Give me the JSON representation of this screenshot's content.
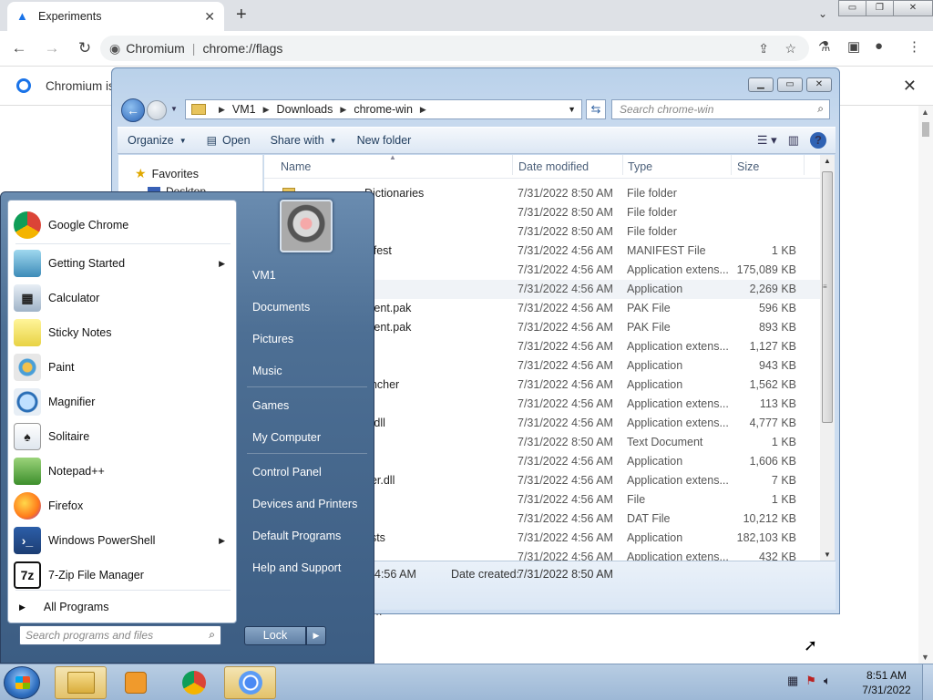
{
  "browser": {
    "tab_title": "Experiments",
    "tab_close": "✕",
    "new_tab": "+",
    "tab_dropdown": "⌄",
    "window_controls": [
      "▭",
      "❐",
      "✕"
    ],
    "site_name": "Chromium",
    "url": "chrome://flags",
    "infobar_text": "Chromium is",
    "infobar_close": "✕",
    "faint_text": "...."
  },
  "explorer": {
    "window_controls": [
      "▭",
      "▭",
      "✕"
    ],
    "breadcrumb": [
      "VM1",
      "Downloads",
      "chrome-win"
    ],
    "search_placeholder": "Search chrome-win",
    "commands": {
      "organize": "Organize",
      "open": "Open",
      "share_with": "Share with",
      "new_folder": "New folder"
    },
    "nav": {
      "favorites": "Favorites",
      "desktop": "Desktop"
    },
    "columns": {
      "name": "Name",
      "date_modified": "Date modified",
      "type": "Type",
      "size": "Size"
    },
    "rows": [
      {
        "name": "Dictionaries",
        "date": "7/31/2022 8:50 AM",
        "type": "File folder",
        "size": ""
      },
      {
        "name": "",
        "date": "7/31/2022 8:50 AM",
        "type": "File folder",
        "size": ""
      },
      {
        "name": "",
        "date": "7/31/2022 8:50 AM",
        "type": "File folder",
        "size": ""
      },
      {
        "name": "nifest",
        "date": "7/31/2022 4:56 AM",
        "type": "MANIFEST File",
        "size": "1 KB"
      },
      {
        "name": "",
        "date": "7/31/2022 4:56 AM",
        "type": "Application extens...",
        "size": "175,089 KB"
      },
      {
        "name": "",
        "date": "7/31/2022 4:56 AM",
        "type": "Application",
        "size": "2,269 KB"
      },
      {
        "name": "rcent.pak",
        "date": "7/31/2022 4:56 AM",
        "type": "PAK File",
        "size": "596 KB"
      },
      {
        "name": "rcent.pak",
        "date": "7/31/2022 4:56 AM",
        "type": "PAK File",
        "size": "893 KB"
      },
      {
        "name": "",
        "date": "7/31/2022 4:56 AM",
        "type": "Application extens...",
        "size": "1,127 KB"
      },
      {
        "name": "",
        "date": "7/31/2022 4:56 AM",
        "type": "Application",
        "size": "943 KB"
      },
      {
        "name": "uncher",
        "date": "7/31/2022 4:56 AM",
        "type": "Application",
        "size": "1,562 KB"
      },
      {
        "name": "",
        "date": "7/31/2022 4:56 AM",
        "type": "Application extens...",
        "size": "113 KB"
      },
      {
        "name": "7.dll",
        "date": "7/31/2022 4:56 AM",
        "type": "Application extens...",
        "size": "4,777 KB"
      },
      {
        "name": "",
        "date": "7/31/2022 8:50 AM",
        "type": "Text Document",
        "size": "1 KB"
      },
      {
        "name": "e",
        "date": "7/31/2022 4:56 AM",
        "type": "Application",
        "size": "1,606 KB"
      },
      {
        "name": "der.dll",
        "date": "7/31/2022 4:56 AM",
        "type": "Application extens...",
        "size": "7 KB"
      },
      {
        "name": "",
        "date": "7/31/2022 4:56 AM",
        "type": "File",
        "size": "1 KB"
      },
      {
        "name": "",
        "date": "7/31/2022 4:56 AM",
        "type": "DAT File",
        "size": "10,212 KB"
      },
      {
        "name": "ests",
        "date": "7/31/2022 4:56 AM",
        "type": "Application",
        "size": "182,103 KB"
      },
      {
        "name": "",
        "date": "7/31/2022 4:56 AM",
        "type": "Application extens...",
        "size": "432 KB"
      }
    ],
    "details": {
      "modified_time": "4:56 AM",
      "date_created_label": "Date created:",
      "date_created_value": "7/31/2022 8:50 AM"
    }
  },
  "start_menu": {
    "programs": [
      {
        "label": "Google Chrome",
        "icon": "chrome-icon",
        "submenu": false
      },
      {
        "label": "Getting Started",
        "icon": "getting-started-icon",
        "submenu": true
      },
      {
        "label": "Calculator",
        "icon": "calculator-icon",
        "submenu": false
      },
      {
        "label": "Sticky Notes",
        "icon": "sticky-notes-icon",
        "submenu": false
      },
      {
        "label": "Paint",
        "icon": "paint-icon",
        "submenu": false
      },
      {
        "label": "Magnifier",
        "icon": "magnifier-icon",
        "submenu": false
      },
      {
        "label": "Solitaire",
        "icon": "solitaire-icon",
        "submenu": false
      },
      {
        "label": "Notepad++",
        "icon": "notepadpp-icon",
        "submenu": false
      },
      {
        "label": "Firefox",
        "icon": "firefox-icon",
        "submenu": false
      },
      {
        "label": "Windows PowerShell",
        "icon": "powershell-icon",
        "submenu": true
      },
      {
        "label": "7-Zip File Manager",
        "icon": "7zip-icon",
        "submenu": false
      }
    ],
    "all_programs": "All Programs",
    "search_placeholder": "Search programs and files",
    "right_links": [
      "VM1",
      "Documents",
      "Pictures",
      "Music",
      "Games",
      "My Computer",
      "Control Panel",
      "Devices and Printers",
      "Default Programs",
      "Help and Support"
    ],
    "lock_label": "Lock"
  },
  "taskbar": {
    "clock_time": "8:51 AM",
    "clock_date": "7/31/2022"
  },
  "colors": {
    "chrome_frame": "#dee1e6",
    "explorer_frame": "#b9d1ea",
    "startmenu_bg": "#4d6f94",
    "taskbar": "#b8cde3"
  }
}
